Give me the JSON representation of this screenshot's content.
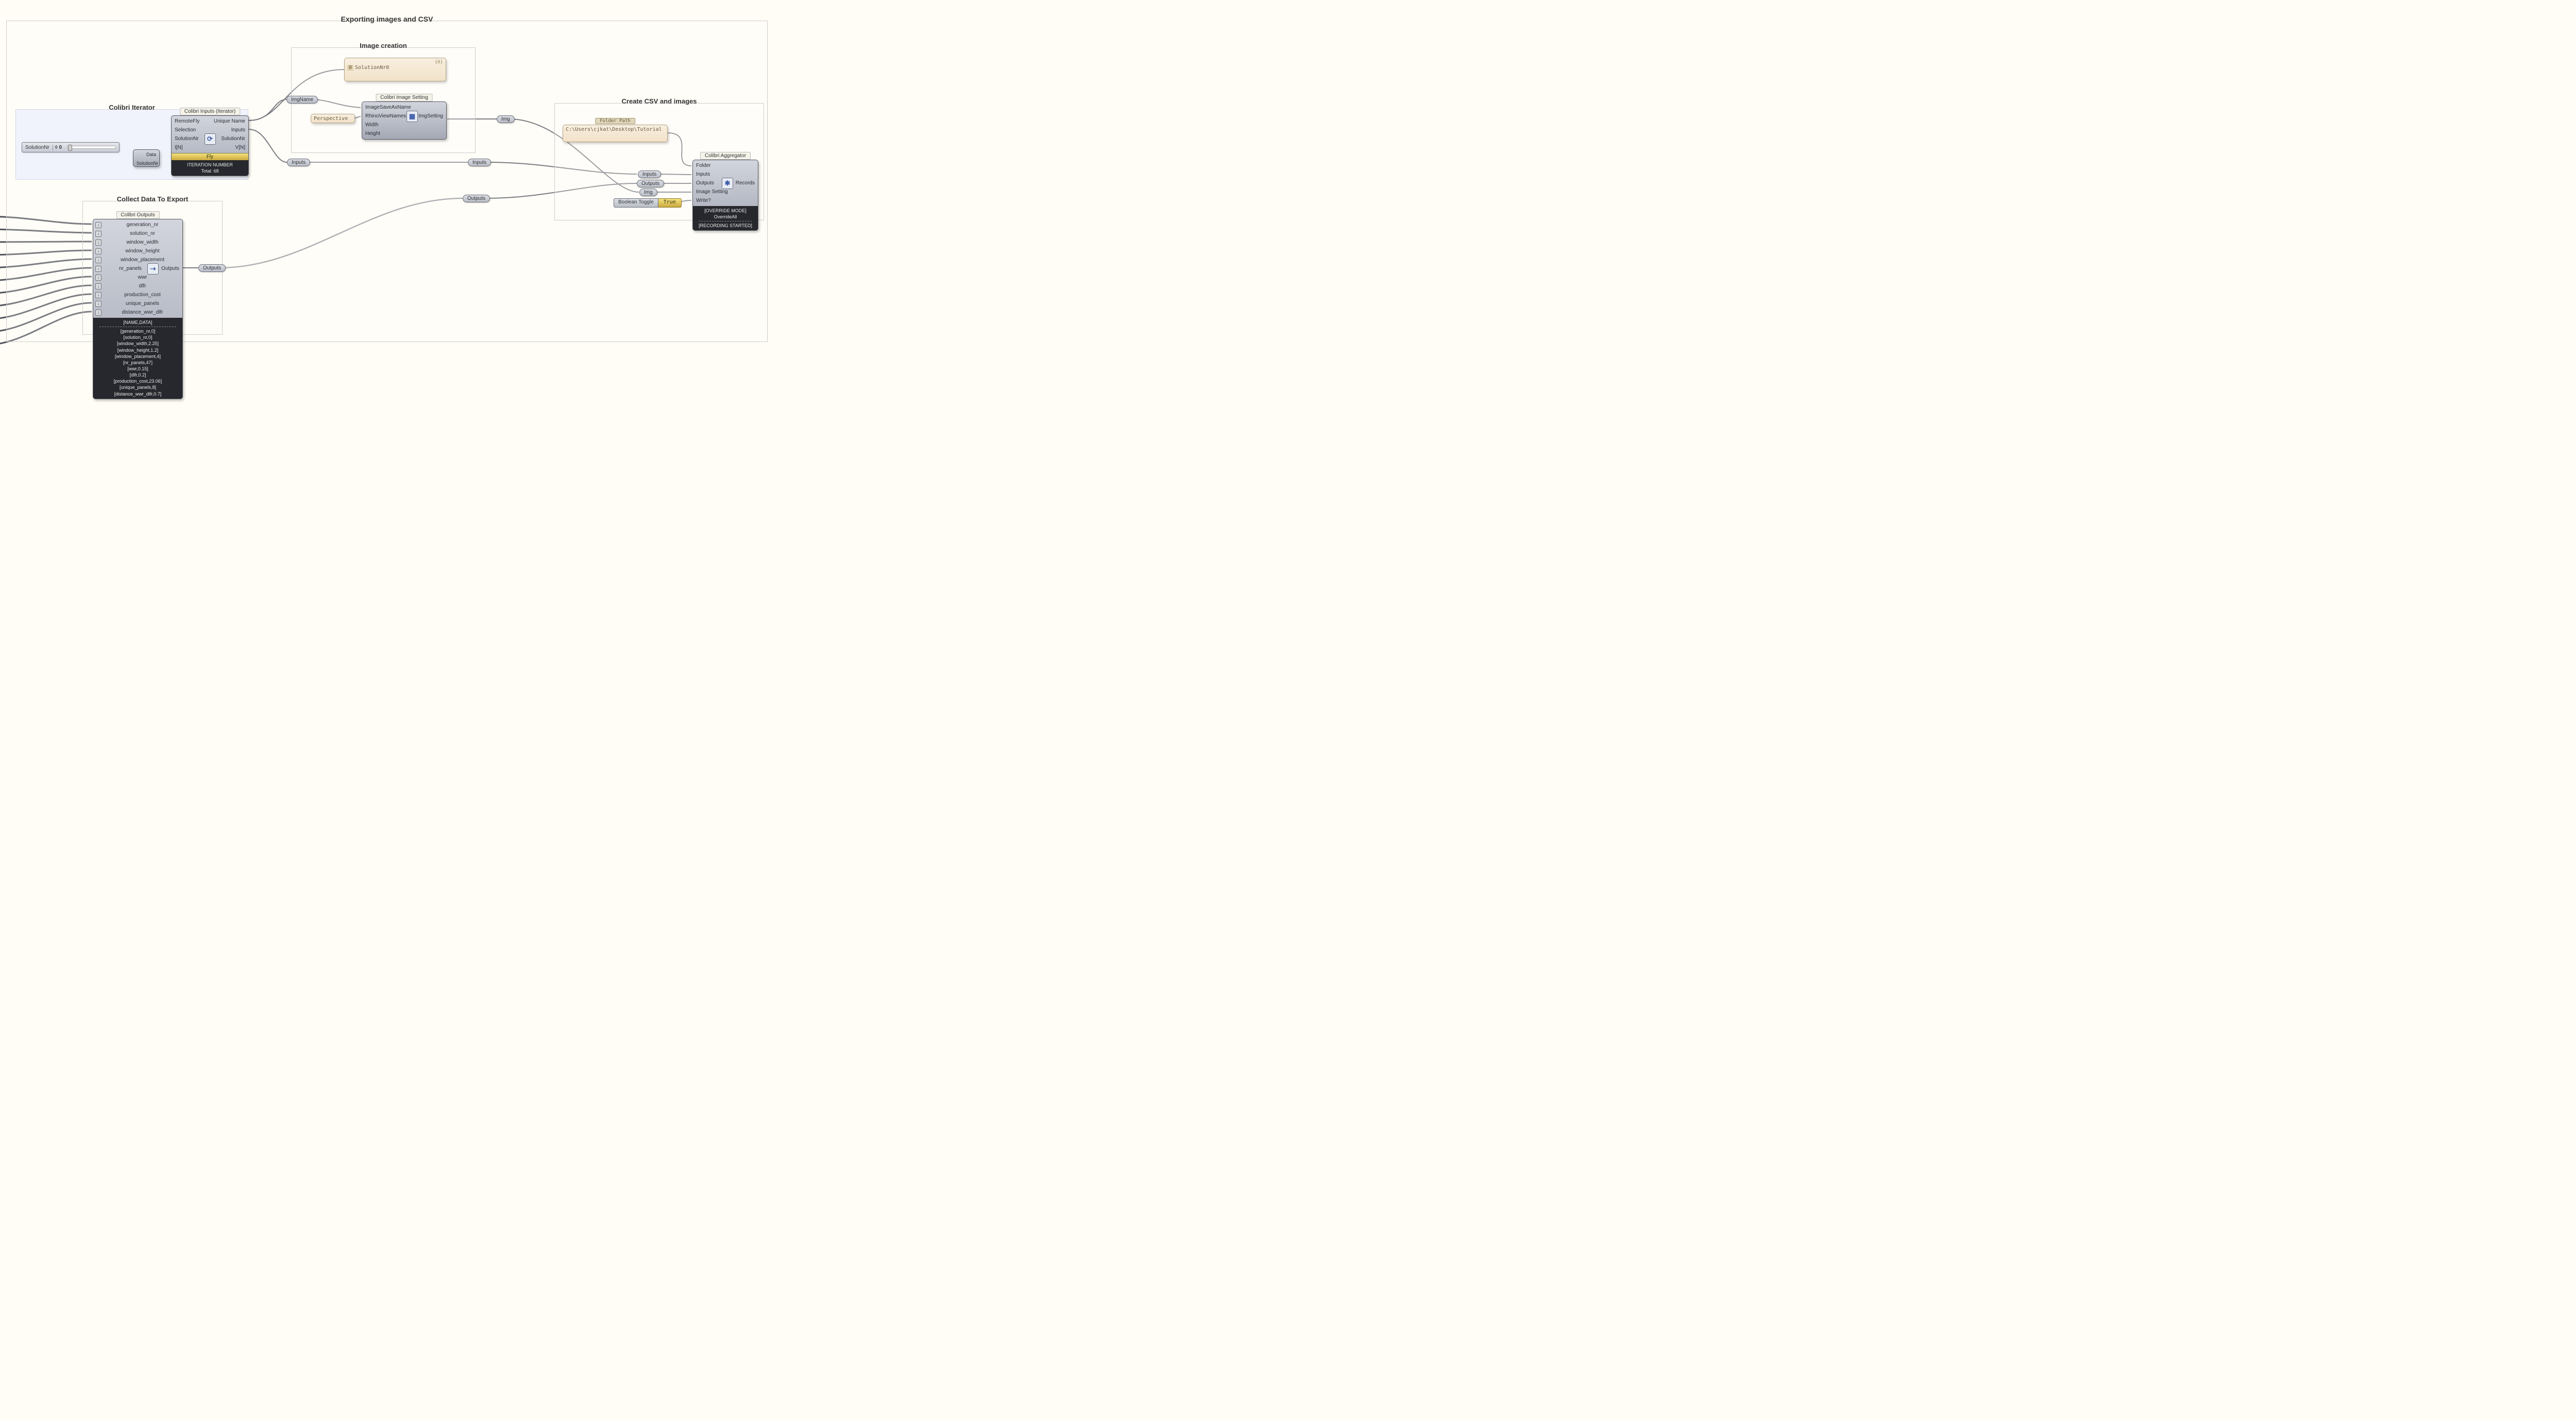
{
  "groups": {
    "main": "Exporting images and CSV",
    "iter": "Colibri Iterator",
    "img": "Image creation",
    "csv": "Create CSV and images",
    "collect": "Collect Data To Export"
  },
  "labels": {
    "iterator_comp": "Colibri Inputs (Iterator)",
    "image_setting_comp": "Colibri Image Setting",
    "aggregator_comp": "Colibri Aggregator",
    "outputs_comp": "Colibri Outputs",
    "folder_panel": "Folder Path"
  },
  "iterator": {
    "in": [
      "RemoteFly",
      "Selection",
      "SolutionNr",
      "I[N]"
    ],
    "out": [
      "Unique Name",
      "Inputs",
      "SolutionNr",
      "V[N]"
    ],
    "fly": "Fly",
    "footer1": "ITERATION NUMBER",
    "footer2": "Total: 68"
  },
  "image_setting": {
    "in": [
      "ImageSaveAsName",
      "RhinoViewNames",
      "Width",
      "Height"
    ],
    "out": "ImgSetting"
  },
  "aggregator": {
    "in": [
      "Folder",
      "Inputs",
      "Outputs",
      "Image Setting",
      "Write?"
    ],
    "out": "Records",
    "footer1": "[OVERRIDE MODE]",
    "footer2": "OverrideAll",
    "footer3": "[RECORDING STARTED]"
  },
  "outputs": {
    "out_label": "Outputs",
    "params": [
      "generation_nr",
      "solution_nr",
      "window_width",
      "window_height",
      "window_placement",
      "nr_panels",
      "wwr",
      "dlfr",
      "production_cost",
      "unique_panels",
      "distance_wwr_dlfr"
    ],
    "footer_head": "[NAME,DATA]",
    "footer_lines": [
      "[generation_nr,0]",
      "[solution_nr,0]",
      "[window_width,2.25]",
      "[window_height,1.2]",
      "[window_placement,4]",
      "[nr_panels,47]",
      "[wwr,0.15]",
      "[dlfr,0.2]",
      "[production_cost,23.06]",
      "[unique_panels,8]",
      "[distance_wwr_dlfr,0.7]"
    ]
  },
  "slider": {
    "name": "SolutionNr",
    "value": "0"
  },
  "minicomp": {
    "data": "Data",
    "sol": "SolutionNr"
  },
  "panel_solution_branch": "{0}",
  "panel_solution_row0": "0",
  "panel_solution_row1": "SolutionNr0",
  "perspective": "Perspective",
  "folder_path": "C:\\Users\\cjkat\\Desktop\\Tutorial",
  "toggle": {
    "label": "Boolean Toggle",
    "value": "True"
  },
  "tags": {
    "imgname": "ImgName",
    "inputs": "Inputs",
    "outputs": "Outputs",
    "img": "Img",
    "inputs2": "Inputs",
    "outputs2": "Outputs",
    "img2": "Img"
  }
}
